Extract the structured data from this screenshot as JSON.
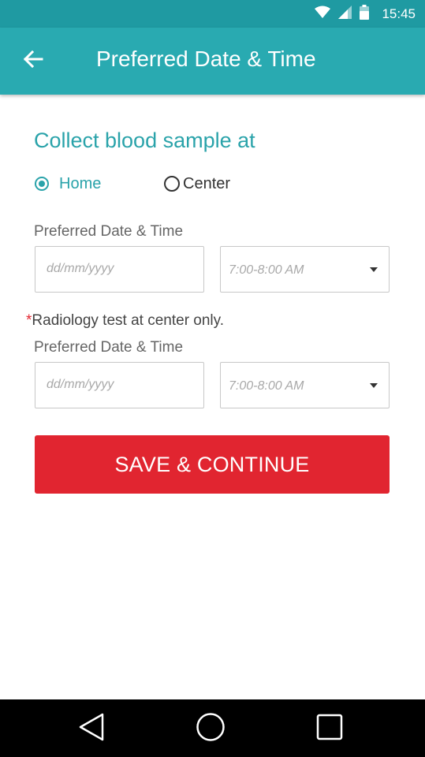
{
  "status_bar": {
    "time": "15:45"
  },
  "app_bar": {
    "title": "Preferred Date & Time"
  },
  "collect": {
    "title": "Collect blood sample at",
    "options": [
      {
        "label": "Home",
        "selected": true
      },
      {
        "label": "Center",
        "selected": false
      }
    ]
  },
  "slot1": {
    "label": "Preferred Date & Time",
    "date_placeholder": "dd/mm/yyyy",
    "time_value": "7:00-8:00 AM"
  },
  "note": {
    "asterisk": "*",
    "text": "Radiology test at center only."
  },
  "slot2": {
    "label": "Preferred Date & Time",
    "date_placeholder": "dd/mm/yyyy",
    "time_value": "7:00-8:00 AM"
  },
  "action": {
    "label": "SAVE & CONTINUE"
  },
  "colors": {
    "status_bar": "#1f9aa2",
    "app_bar": "#29aab1",
    "accent": "#2aa3aa",
    "button": "#e12530"
  }
}
